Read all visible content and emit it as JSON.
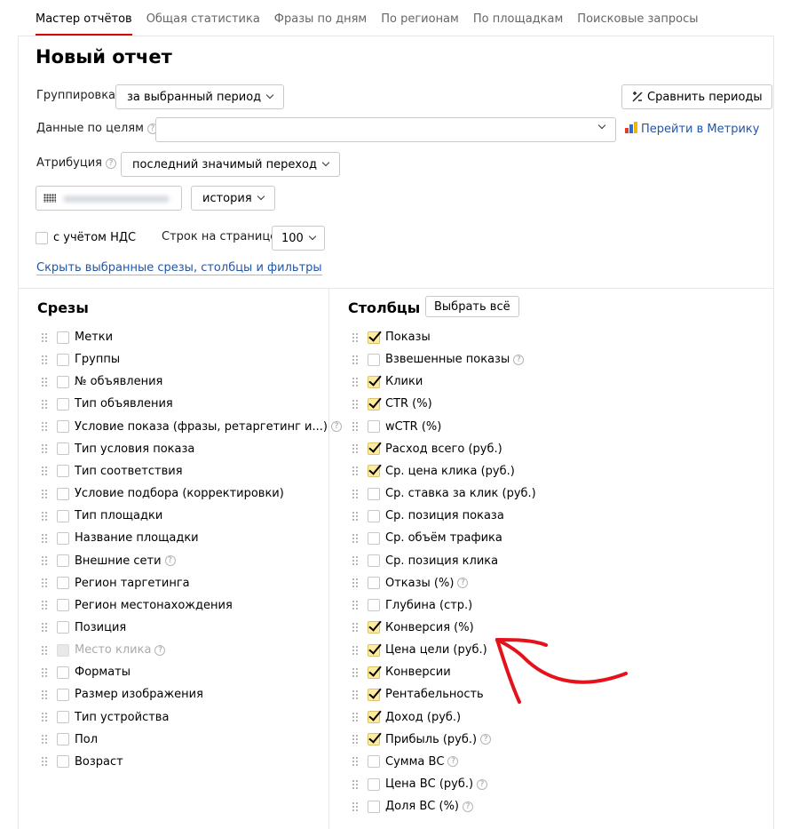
{
  "tabs": [
    {
      "label": "Мастер отчётов",
      "active": true
    },
    {
      "label": "Общая статистика"
    },
    {
      "label": "Фразы по дням"
    },
    {
      "label": "По регионам"
    },
    {
      "label": "По площадкам"
    },
    {
      "label": "Поисковые запросы"
    }
  ],
  "title": "Новый отчет",
  "grouping": {
    "label": "Группировка",
    "value": "за выбранный период"
  },
  "compare_button": "Сравнить периоды",
  "goals": {
    "label": "Данные по целям",
    "help": "?",
    "value": "",
    "link": "Перейти в Метрику"
  },
  "attribution": {
    "label": "Атрибуция",
    "help": "?",
    "value": "последний значимый переход"
  },
  "campaign_selector": {
    "value": "",
    "history_label": "история"
  },
  "vat": {
    "label": "с учётом НДС",
    "checked": false
  },
  "rows_per_page": {
    "label": "Строк на странице",
    "value": "100"
  },
  "hide_link": "Скрыть выбранные срезы, столбцы и фильтры",
  "slices": {
    "title": "Срезы",
    "items": [
      {
        "label": "Метки"
      },
      {
        "label": "Группы"
      },
      {
        "label": "№ объявления"
      },
      {
        "label": "Тип объявления"
      },
      {
        "label": "Условие показа (фразы, ретаргетинг и...)",
        "help": "?"
      },
      {
        "label": "Тип условия показа"
      },
      {
        "label": "Тип соответствия"
      },
      {
        "label": "Условие подбора (корректировки)"
      },
      {
        "label": "Тип площадки"
      },
      {
        "label": "Название площадки"
      },
      {
        "label": "Внешние сети",
        "help": "?"
      },
      {
        "label": "Регион таргетинга"
      },
      {
        "label": "Регион местонахождения"
      },
      {
        "label": "Позиция"
      },
      {
        "label": "Место клика",
        "help": "?",
        "disabled": true
      },
      {
        "label": "Форматы"
      },
      {
        "label": "Размер изображения"
      },
      {
        "label": "Тип устройства"
      },
      {
        "label": "Пол"
      },
      {
        "label": "Возраст"
      }
    ]
  },
  "columns": {
    "title": "Столбцы",
    "select_all": "Выбрать всё",
    "items": [
      {
        "label": "Показы",
        "checked": true
      },
      {
        "label": "Взвешенные показы",
        "help": "?"
      },
      {
        "label": "Клики",
        "checked": true
      },
      {
        "label": "CTR (%)",
        "checked": true
      },
      {
        "label": "wCTR (%)"
      },
      {
        "label": "Расход всего (руб.)",
        "checked": true
      },
      {
        "label": "Ср. цена клика (руб.)",
        "checked": true
      },
      {
        "label": "Ср. ставка за клик (руб.)"
      },
      {
        "label": "Ср. позиция показа"
      },
      {
        "label": "Ср. объём трафика"
      },
      {
        "label": "Ср. позиция клика"
      },
      {
        "label": "Отказы (%)",
        "help": "?"
      },
      {
        "label": "Глубина (стр.)"
      },
      {
        "label": "Конверсия (%)",
        "checked": true
      },
      {
        "label": "Цена цели (руб.)",
        "checked": true
      },
      {
        "label": "Конверсии",
        "checked": true
      },
      {
        "label": "Рентабельность",
        "checked": true
      },
      {
        "label": "Доход (руб.)",
        "checked": true
      },
      {
        "label": "Прибыль (руб.)",
        "checked": true,
        "help": "?"
      },
      {
        "label": "Сумма ВС",
        "help": "?"
      },
      {
        "label": "Цена ВС (руб.)",
        "help": "?"
      },
      {
        "label": "Доля ВС (%)",
        "help": "?"
      }
    ]
  },
  "colors": {
    "accent": "#d40d00",
    "link": "#2255aa",
    "check": "#ffeba0",
    "arrow": "#e3121b"
  }
}
